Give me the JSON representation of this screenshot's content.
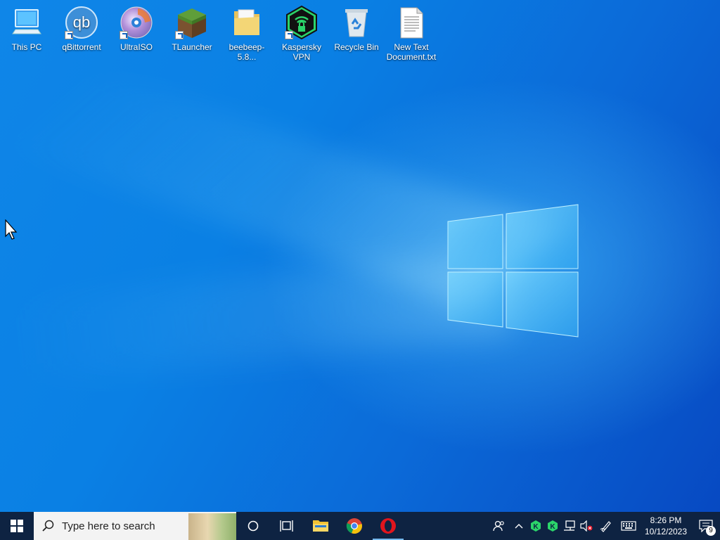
{
  "desktop": {
    "icons": [
      {
        "label": "This PC",
        "icon": "computer-icon"
      },
      {
        "label": "qBittorrent",
        "icon": "qbittorrent-icon"
      },
      {
        "label": "UltraISO",
        "icon": "disc-icon"
      },
      {
        "label": "TLauncher",
        "icon": "minecraft-grass-block-icon"
      },
      {
        "label": "beebeep-5.8...",
        "icon": "folder-icon"
      },
      {
        "label": "Kaspersky VPN",
        "icon": "kaspersky-vpn-icon"
      },
      {
        "label": "Recycle Bin",
        "icon": "recycle-bin-icon"
      },
      {
        "label": "New Text Document.txt",
        "icon": "text-document-icon"
      }
    ]
  },
  "taskbar": {
    "search_placeholder": "Type here to search",
    "pinned": [
      {
        "name": "cortana",
        "icon": "cortana-circle-icon"
      },
      {
        "name": "task-view",
        "icon": "task-view-icon"
      },
      {
        "name": "file-explorer",
        "icon": "folder-icon"
      },
      {
        "name": "chrome",
        "icon": "chrome-icon"
      },
      {
        "name": "opera",
        "icon": "opera-icon",
        "active": true
      }
    ],
    "tray": {
      "clock_time": "8:26 PM",
      "clock_date": "10/12/2023",
      "notification_count": "9"
    }
  },
  "colors": {
    "desktop_blue": "#0a80e4",
    "taskbar": "#0e2342",
    "active_indicator": "#76b9ed"
  }
}
